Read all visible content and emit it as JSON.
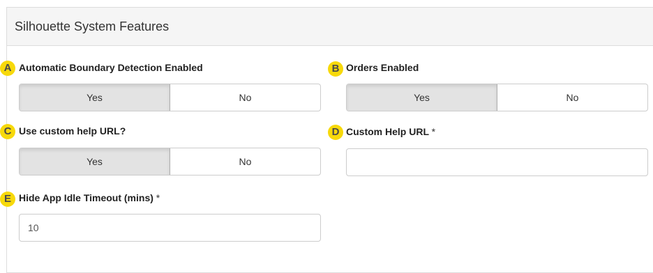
{
  "panel": {
    "title": "Silhouette System Features"
  },
  "fields": {
    "auto_boundary": {
      "badge": "A",
      "label": "Automatic Boundary Detection Enabled",
      "yes": "Yes",
      "no": "No",
      "selected": "Yes"
    },
    "orders": {
      "badge": "B",
      "label": "Orders Enabled",
      "yes": "Yes",
      "no": "No",
      "selected": "Yes"
    },
    "custom_help": {
      "badge": "C",
      "label": "Use custom help URL?",
      "yes": "Yes",
      "no": "No",
      "selected": "Yes"
    },
    "custom_help_url": {
      "badge": "D",
      "label": "Custom Help URL",
      "required_mark": "*",
      "value": ""
    },
    "idle_timeout": {
      "badge": "E",
      "label": "Hide App Idle Timeout (mins)",
      "required_mark": "*",
      "value": "10"
    }
  },
  "colors": {
    "badge": "#f7d90b",
    "active_toggle": "#e3e3e3",
    "heading_bg": "#f5f5f5"
  }
}
